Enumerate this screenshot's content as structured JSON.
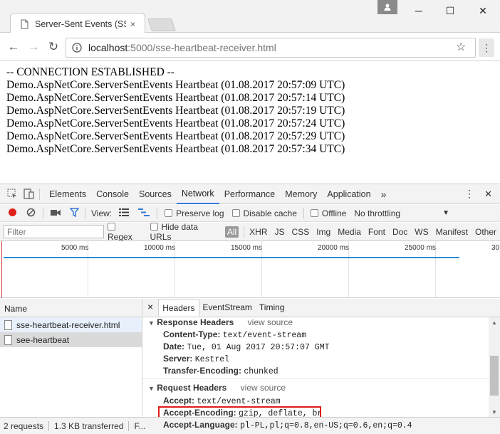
{
  "window": {
    "tab_title": "Server-Sent Events (SSE)",
    "tab_close": "×",
    "minimize": "─",
    "maximize": "☐",
    "close": "✕",
    "profile_icon": "person-icon"
  },
  "toolbar": {
    "back": "←",
    "forward": "→",
    "reload": "↻",
    "url_host": "localhost",
    "url_path": ":5000/sse-heartbeat-receiver.html",
    "star": "☆",
    "menu": "⋮"
  },
  "page": {
    "lines": [
      "-- CONNECTION ESTABLISHED --",
      "Demo.AspNetCore.ServerSentEvents Heartbeat (01.08.2017 20:57:09 UTC)",
      "Demo.AspNetCore.ServerSentEvents Heartbeat (01.08.2017 20:57:14 UTC)",
      "Demo.AspNetCore.ServerSentEvents Heartbeat (01.08.2017 20:57:19 UTC)",
      "Demo.AspNetCore.ServerSentEvents Heartbeat (01.08.2017 20:57:24 UTC)",
      "Demo.AspNetCore.ServerSentEvents Heartbeat (01.08.2017 20:57:29 UTC)",
      "Demo.AspNetCore.ServerSentEvents Heartbeat (01.08.2017 20:57:34 UTC)"
    ]
  },
  "devtools": {
    "tabs": [
      "Elements",
      "Console",
      "Sources",
      "Network",
      "Performance",
      "Memory",
      "Application"
    ],
    "more": "»",
    "menu": "⋮",
    "close": "✕",
    "view_label": "View:",
    "preserve_log": "Preserve log",
    "disable_cache": "Disable cache",
    "offline": "Offline",
    "throttling": "No throttling",
    "filter_placeholder": "Filter",
    "regex": "Regex",
    "hide_data_urls": "Hide data URLs",
    "types": [
      "All",
      "XHR",
      "JS",
      "CSS",
      "Img",
      "Media",
      "Font",
      "Doc",
      "WS",
      "Manifest",
      "Other"
    ],
    "ruler": [
      "5000 ms",
      "10000 ms",
      "15000 ms",
      "20000 ms",
      "25000 ms",
      "30"
    ],
    "name_header": "Name",
    "requests": [
      "sse-heartbeat-receiver.html",
      "see-heartbeat"
    ],
    "detail_close": "×",
    "detail_tabs": [
      "Headers",
      "EventStream",
      "Timing"
    ],
    "response_headers_title": "Response Headers",
    "request_headers_title": "Request Headers",
    "view_source": "view source",
    "response_headers": [
      {
        "key": "Content-Type:",
        "value": "text/event-stream"
      },
      {
        "key": "Date:",
        "value": "Tue, 01 Aug 2017 20:57:07 GMT"
      },
      {
        "key": "Server:",
        "value": "Kestrel"
      },
      {
        "key": "Transfer-Encoding:",
        "value": "chunked"
      }
    ],
    "request_headers": [
      {
        "key": "Accept:",
        "value": "text/event-stream"
      },
      {
        "key": "Accept-Encoding:",
        "value": "gzip, deflate, br"
      },
      {
        "key": "Accept-Language:",
        "value": "pl-PL,pl;q=0.8,en-US;q=0.6,en;q=0.4"
      }
    ],
    "status": {
      "requests": "2 requests",
      "transferred": "1.3 KB transferred",
      "finish": "F..."
    }
  },
  "colors": {
    "accent": "#3879d9",
    "record": "#e0201b",
    "highlight": "#e01b1b"
  }
}
